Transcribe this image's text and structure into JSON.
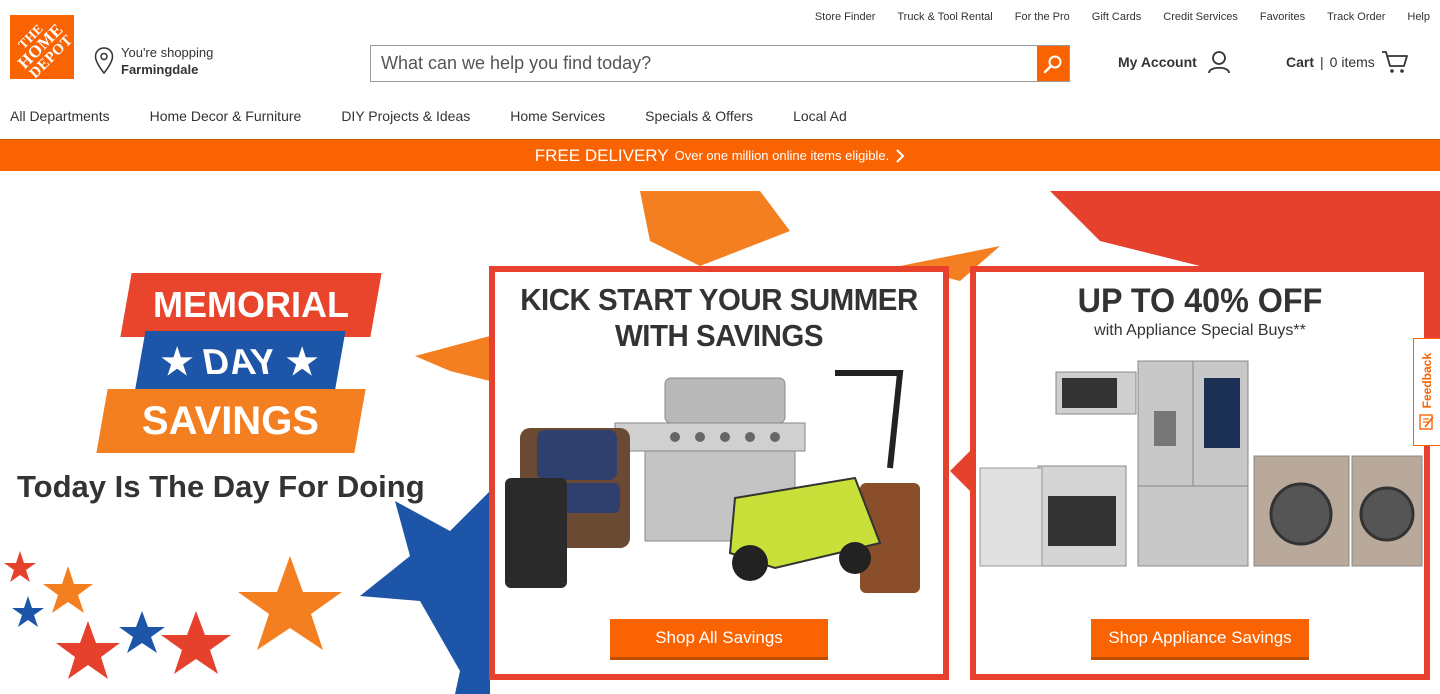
{
  "brand": {
    "logo_lines": [
      "THE",
      "HOME",
      "DEPOT"
    ],
    "color": "#f96302"
  },
  "utility_nav": [
    "Store Finder",
    "Truck & Tool Rental",
    "For the Pro",
    "Gift Cards",
    "Credit Services",
    "Favorites",
    "Track Order",
    "Help"
  ],
  "store": {
    "prefix": "You're shopping",
    "name": "Farmingdale"
  },
  "search": {
    "placeholder": "What can we help you find today?",
    "value": ""
  },
  "account": {
    "label": "My Account"
  },
  "cart": {
    "label": "Cart",
    "count_text": "0 items"
  },
  "main_nav": [
    "All Departments",
    "Home Decor & Furniture",
    "DIY Projects & Ideas",
    "Home Services",
    "Specials & Offers",
    "Local Ad"
  ],
  "promo": {
    "main": "FREE DELIVERY",
    "sub": "Over one million online items eligible."
  },
  "hero": {
    "banner": {
      "line1": "MEMORIAL",
      "line2": "DAY",
      "line3": "SAVINGS"
    },
    "tagline": "Today Is The Day For Doing",
    "card1": {
      "title_line1": "KICK START YOUR SUMMER",
      "title_line2": "WITH SAVINGS",
      "button": "Shop All Savings"
    },
    "card2": {
      "title": "UP TO 40% OFF",
      "subtitle": "with Appliance Special Buys**",
      "button": "Shop Appliance Savings"
    }
  },
  "feedback": {
    "label": "Feedback"
  },
  "colors": {
    "accent": "#f96302",
    "red": "#e6412c",
    "blue": "#1d55a8"
  }
}
